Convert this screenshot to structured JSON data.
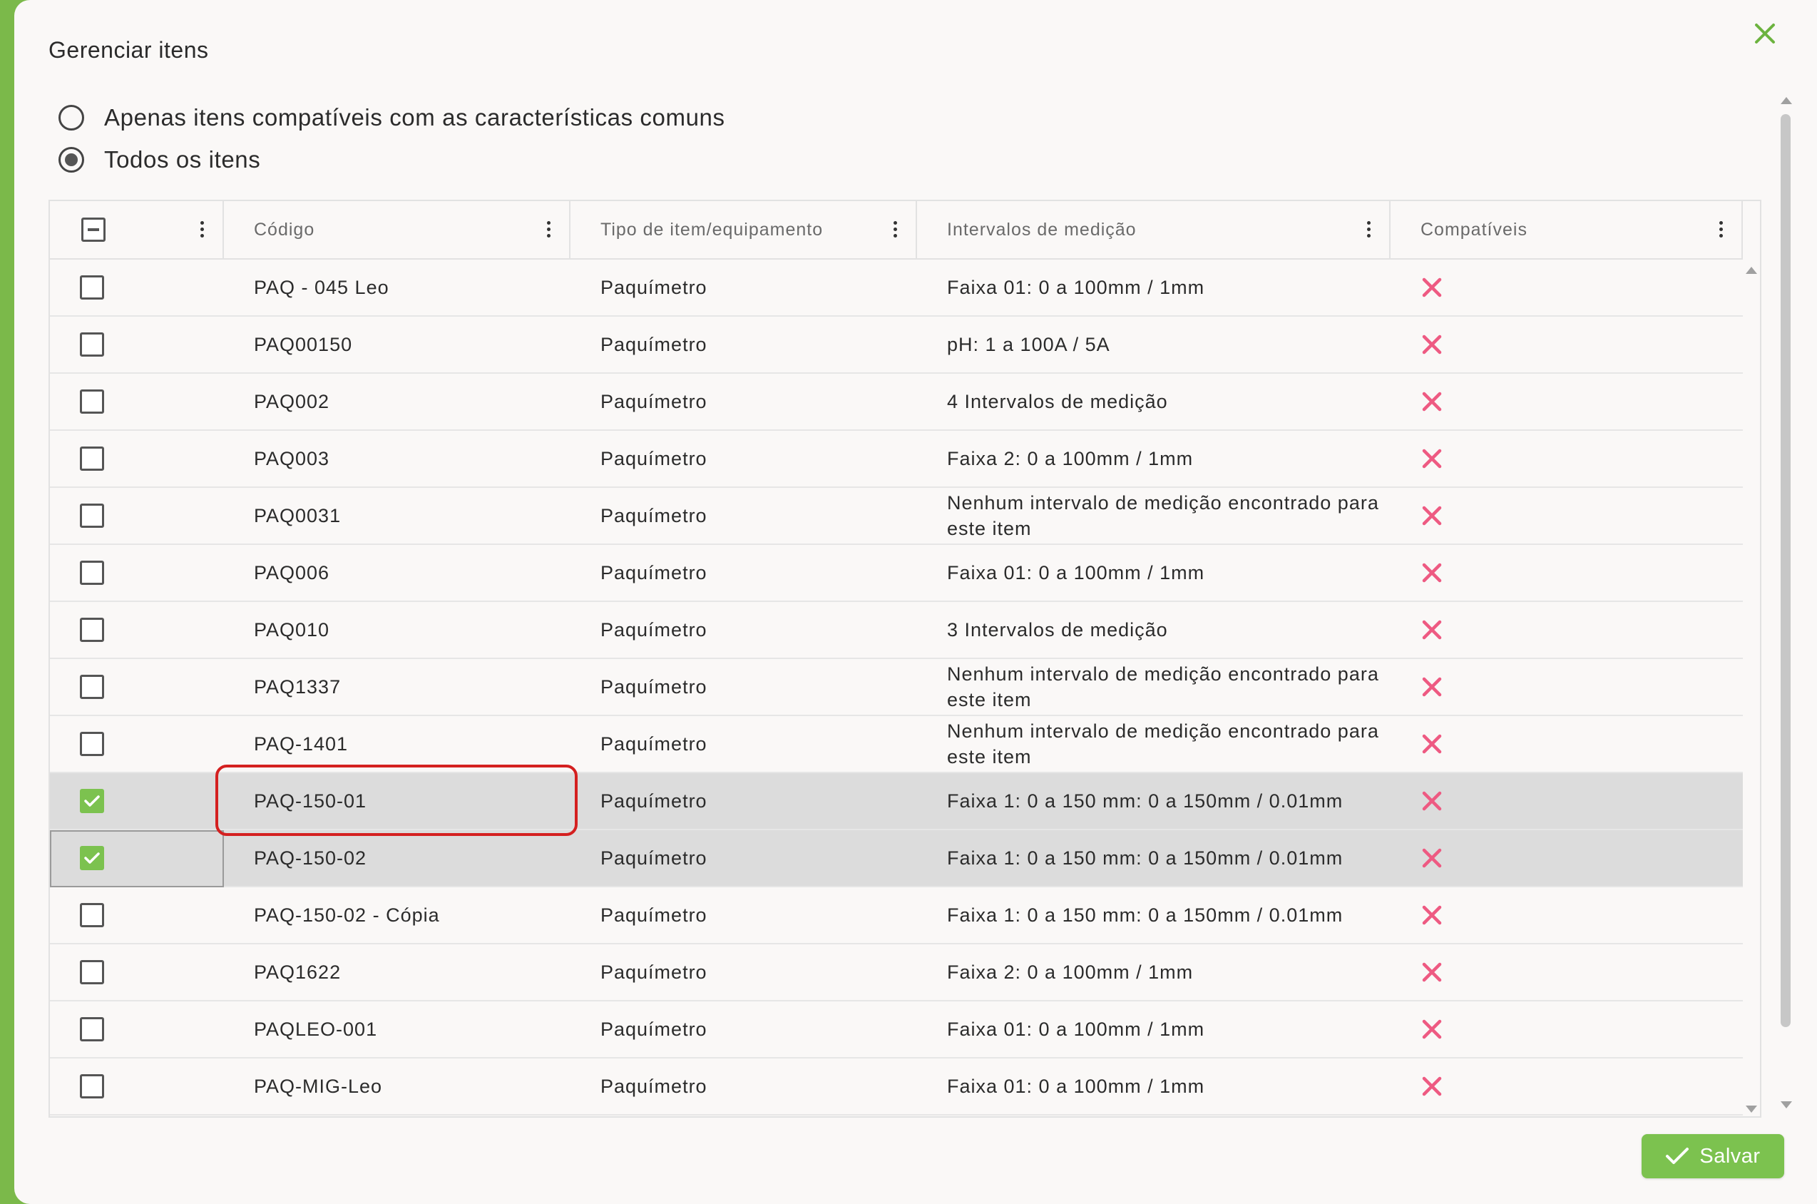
{
  "dialog": {
    "title": "Gerenciar itens",
    "close_icon": "close-icon",
    "accent_color": "#7cc24f"
  },
  "filter": {
    "options": [
      {
        "label": "Apenas itens compatíveis com as características comuns",
        "selected": false
      },
      {
        "label": "Todos os itens",
        "selected": true
      }
    ]
  },
  "table": {
    "columns": [
      "Código",
      "Tipo de item/equipamento",
      "Intervalos de medição",
      "Compatíveis"
    ],
    "rows": [
      {
        "code": "PAQ - 045 Leo",
        "type": "Paquímetro",
        "range": "Faixa 01: 0 a 100mm / 1mm",
        "compatible": false,
        "checked": false
      },
      {
        "code": "PAQ00150",
        "type": "Paquímetro",
        "range": "pH: 1 a 100A / 5A",
        "compatible": false,
        "checked": false
      },
      {
        "code": "PAQ002",
        "type": "Paquímetro",
        "range": "4 Intervalos de medição",
        "compatible": false,
        "checked": false
      },
      {
        "code": "PAQ003",
        "type": "Paquímetro",
        "range": "Faixa 2: 0 a 100mm / 1mm",
        "compatible": false,
        "checked": false
      },
      {
        "code": "PAQ0031",
        "type": "Paquímetro",
        "range": "Nenhum intervalo de medição encontrado para este item",
        "compatible": false,
        "checked": false
      },
      {
        "code": "PAQ006",
        "type": "Paquímetro",
        "range": "Faixa 01: 0 a 100mm / 1mm",
        "compatible": false,
        "checked": false
      },
      {
        "code": "PAQ010",
        "type": "Paquímetro",
        "range": "3 Intervalos de medição",
        "compatible": false,
        "checked": false
      },
      {
        "code": "PAQ1337",
        "type": "Paquímetro",
        "range": "Nenhum intervalo de medição encontrado para este item",
        "compatible": false,
        "checked": false
      },
      {
        "code": "PAQ-1401",
        "type": "Paquímetro",
        "range": "Nenhum intervalo de medição encontrado para este item",
        "compatible": false,
        "checked": false
      },
      {
        "code": "PAQ-150-01",
        "type": "Paquímetro",
        "range": "Faixa 1: 0 a 150 mm: 0 a 150mm / 0.01mm",
        "compatible": false,
        "checked": true
      },
      {
        "code": "PAQ-150-02",
        "type": "Paquímetro",
        "range": "Faixa 1: 0 a 150 mm: 0 a 150mm / 0.01mm",
        "compatible": false,
        "checked": true
      },
      {
        "code": "PAQ-150-02 - Cópia",
        "type": "Paquímetro",
        "range": "Faixa 1: 0 a 150 mm: 0 a 150mm / 0.01mm",
        "compatible": false,
        "checked": false
      },
      {
        "code": "PAQ1622",
        "type": "Paquímetro",
        "range": "Faixa 2: 0 a 100mm / 1mm",
        "compatible": false,
        "checked": false
      },
      {
        "code": "PAQLEO-001",
        "type": "Paquímetro",
        "range": "Faixa 01: 0 a 100mm / 1mm",
        "compatible": false,
        "checked": false
      },
      {
        "code": "PAQ-MIG-Leo",
        "type": "Paquímetro",
        "range": "Faixa 01: 0 a 100mm / 1mm",
        "compatible": false,
        "checked": false
      }
    ],
    "incompatible_icon": "x-icon",
    "incompatible_color": "#ee5a82"
  },
  "footer": {
    "save_label": "Salvar",
    "save_icon": "check-icon"
  }
}
